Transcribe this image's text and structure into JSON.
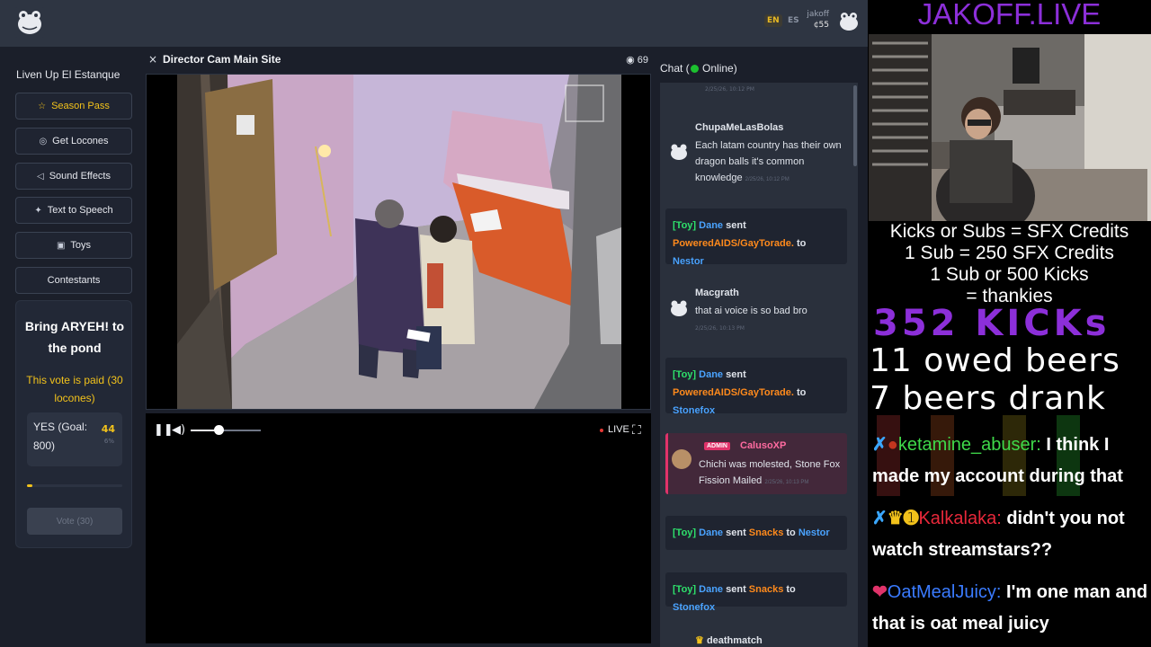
{
  "header": {
    "lang_en": "EN",
    "lang_es": "ES",
    "username": "jakoff",
    "balance": "¢55"
  },
  "sidebar": {
    "title": "Liven Up El Estanque",
    "buttons": [
      {
        "label": "Season Pass",
        "icon": "star-icon"
      },
      {
        "label": "Get Locones",
        "icon": "coin-icon"
      },
      {
        "label": "Sound Effects",
        "icon": "speaker-icon"
      },
      {
        "label": "Text to Speech",
        "icon": "sparkle-icon"
      },
      {
        "label": "Toys",
        "icon": "gift-icon"
      },
      {
        "label": "Contestants",
        "icon": ""
      }
    ],
    "vote": {
      "title": "Bring ARYEH! to the pond",
      "paid_text": "This vote is paid (30 locones)",
      "option_label": "YES (Goal: 800)",
      "option_count": "44",
      "option_pct": "6%",
      "progress": 0.055,
      "vote_button": "Vote (30)"
    }
  },
  "player": {
    "close": "×",
    "title": "Director Cam Main Site",
    "viewers": "69",
    "live_label": "LIVE",
    "volume": 0.4
  },
  "chat": {
    "title_prefix": "Chat (",
    "status": "Online)",
    "top_timestamp": "2/25/26, 10:12 PM",
    "messages": [
      {
        "name": "ChupaMeLasBolas",
        "text": "Each latam country has their own dragon balls it's common knowledge",
        "time": "2/25/26, 10:12 PM"
      },
      {
        "name": "Macgrath",
        "text": "that ai voice is so bad bro",
        "time": "2/25/26, 10:13 PM"
      }
    ],
    "events": [
      {
        "tag": "[Toy]",
        "user": "Dane",
        "verb": "sent",
        "item": "PoweredAIDS/GayTorade.",
        "to": "to",
        "target": "Nestor"
      },
      {
        "tag": "[Toy]",
        "user": "Dane",
        "verb": "sent",
        "item": "PoweredAIDS/GayTorade.",
        "to": "to",
        "target": "Stonefox"
      },
      {
        "tag": "[Toy]",
        "user": "Dane",
        "verb": "sent",
        "item": "Snacks",
        "to": "to",
        "target": "Nestor"
      },
      {
        "tag": "[Toy]",
        "user": "Dane",
        "verb": "sent",
        "item": "Snacks",
        "to": "to",
        "target": "Stonefox"
      }
    ],
    "admin": {
      "badge": "ADMIN",
      "name": "CalusoXP",
      "text": "Chichi was molested, Stone Fox Fission Mailed",
      "time": "2/25/26, 10:13 PM"
    },
    "last_name": "deathmatch"
  },
  "overlay": {
    "title": "JAKOFF.LIVE",
    "rules": [
      "Kicks or Subs = SFX Credits",
      "1 Sub = 250 SFX Credits",
      "1 Sub or 500 Kicks",
      "= thankies"
    ],
    "kicks": "352 KICKs",
    "owed": "11 owed beers",
    "drank": "7 beers drank",
    "chat": [
      {
        "user": "ketamine_abuser:",
        "text": "I think I made my account during that",
        "color": "#3fd94a"
      },
      {
        "user": "Kalkalaka:",
        "text": "didn't you not watch streamstars??",
        "color": "#e8283a"
      },
      {
        "user": "OatMealJuicy:",
        "text": "I'm one man and that is oat meal juicy",
        "color": "#3a7bff"
      }
    ]
  },
  "colors": {
    "accent_gold": "#f2c21b",
    "online_green": "#1cc02f",
    "overlay_purple": "#8c2fd9",
    "admin_pink": "#e0336a"
  }
}
